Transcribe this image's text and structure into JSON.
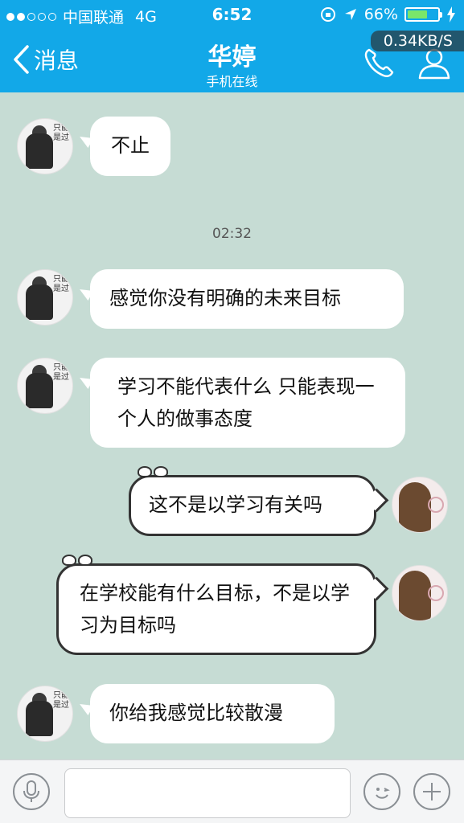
{
  "status_bar": {
    "carrier": "中国联通",
    "network": "4G",
    "time": "6:52",
    "battery_percent": "66%",
    "battery_level": 0.66,
    "signal_dots_filled": 2,
    "signal_dots_total": 5
  },
  "nav": {
    "back_label": "消息",
    "contact_name": "华婷",
    "contact_status": "手机在线",
    "speed_overlay": "0.34KB/S"
  },
  "messages": [
    {
      "sender": "other",
      "text": "不止"
    },
    {
      "sender": "other",
      "text": "感觉你没有明确的未来目标"
    },
    {
      "sender": "other",
      "text": "学习不能代表什么 只能表现一个人的做事态度"
    },
    {
      "sender": "self",
      "text": "这不是以学习有关吗"
    },
    {
      "sender": "self",
      "text": "在学校能有什么目标，不是以学习为目标吗"
    },
    {
      "sender": "other",
      "text": "你给我感觉比较散漫"
    }
  ],
  "timestamp": "02:32",
  "avatar_text": "只能是过",
  "colors": {
    "header": "#12a8e8",
    "chat_background": "#c6dcd4",
    "battery_fill": "#7ae66a"
  },
  "icons": {
    "phone": "phone-icon",
    "contact": "contact-icon",
    "voice": "microphone-icon",
    "emoji": "emoji-icon",
    "add": "plus-icon"
  }
}
